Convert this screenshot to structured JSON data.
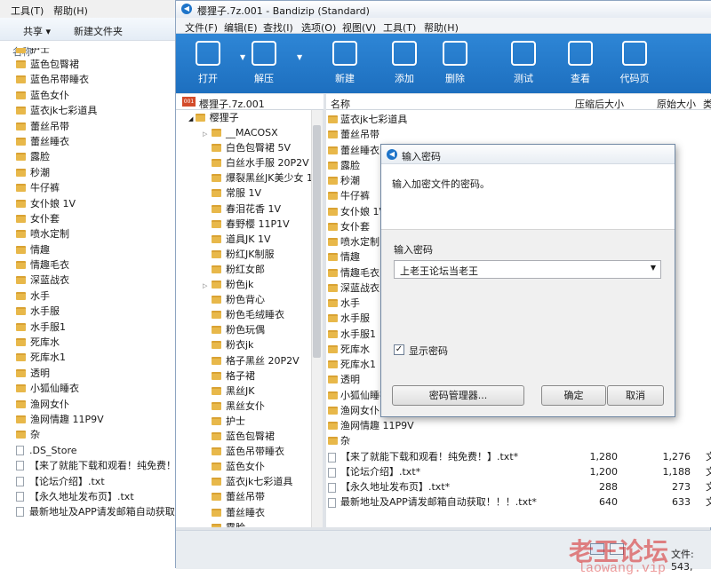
{
  "explorer": {
    "menu": [
      "工具(T)",
      "帮助(H)"
    ],
    "toolbar": {
      "share": "共享 ▾",
      "new_folder": "新建文件夹"
    },
    "col_name": "名称",
    "partial_top": "护士",
    "items": [
      {
        "n": "蓝色包臀裙",
        "t": "folder"
      },
      {
        "n": "蓝色吊带睡衣",
        "t": "folder"
      },
      {
        "n": "蓝色女仆",
        "t": "folder"
      },
      {
        "n": "蓝衣jk七彩道具",
        "t": "folder"
      },
      {
        "n": "蕾丝吊带",
        "t": "folder"
      },
      {
        "n": "蕾丝睡衣",
        "t": "folder"
      },
      {
        "n": "露脸",
        "t": "folder"
      },
      {
        "n": "秒潮",
        "t": "folder"
      },
      {
        "n": "牛仔裤",
        "t": "folder"
      },
      {
        "n": "女仆娘 1V",
        "t": "folder"
      },
      {
        "n": "女仆套",
        "t": "folder"
      },
      {
        "n": "喷水定制",
        "t": "folder"
      },
      {
        "n": "情趣",
        "t": "folder"
      },
      {
        "n": "情趣毛衣",
        "t": "folder"
      },
      {
        "n": "深蓝战衣",
        "t": "folder"
      },
      {
        "n": "水手",
        "t": "folder"
      },
      {
        "n": "水手服",
        "t": "folder"
      },
      {
        "n": "水手服1",
        "t": "folder"
      },
      {
        "n": "死库水",
        "t": "folder"
      },
      {
        "n": "死库水1",
        "t": "folder"
      },
      {
        "n": "透明",
        "t": "folder"
      },
      {
        "n": "小狐仙睡衣",
        "t": "folder"
      },
      {
        "n": "渔网女仆",
        "t": "folder"
      },
      {
        "n": "渔网情趣 11P9V",
        "t": "folder"
      },
      {
        "n": "杂",
        "t": "folder"
      },
      {
        "n": ".DS_Store",
        "t": "file"
      },
      {
        "n": "【来了就能下载和观看！纯免费！】.txt",
        "t": "file"
      },
      {
        "n": "【论坛介绍】.txt",
        "t": "file"
      },
      {
        "n": "【永久地址发布页】.txt",
        "t": "file"
      },
      {
        "n": "最新地址及APP请发邮箱自动获取！！！.txt",
        "t": "file"
      }
    ]
  },
  "bandizip": {
    "title": "樱狸子.7z.001 - Bandizip (Standard)",
    "menu": [
      "文件(F)",
      "编辑(E)",
      "查找(I)",
      "选项(O)",
      "视图(V)",
      "工具(T)",
      "帮助(H)"
    ],
    "toolbar": [
      {
        "label": "打开",
        "icon": "open-icon"
      },
      {
        "label": "解压",
        "icon": "extract-icon"
      },
      {
        "label": "新建",
        "icon": "new-archive-icon"
      },
      {
        "label": "添加",
        "icon": "add-icon"
      },
      {
        "label": "删除",
        "icon": "delete-icon"
      },
      {
        "label": "测试",
        "icon": "test-icon"
      },
      {
        "label": "查看",
        "icon": "view-icon"
      },
      {
        "label": "代码页",
        "icon": "codepage-icon"
      }
    ],
    "archive_name": "樱狸子.7z.001",
    "tree_root": "樱狸子",
    "tree_items": [
      "__MACOSX",
      "白色包臀裙 5V",
      "白丝水手服 20P2V",
      "爆裂黑丝JK美少女 1",
      "常服 1V",
      "春泪花香 1V",
      "春野樱 11P1V",
      "道具JK 1V",
      "粉红JK制服",
      "粉红女郎",
      "粉色jk",
      "粉色背心",
      "粉色毛绒睡衣",
      "粉色玩偶",
      "粉衣jk",
      "格子黑丝 20P2V",
      "格子裙",
      "黑丝JK",
      "黑丝女仆",
      "护士",
      "蓝色包臀裙",
      "蓝色吊带睡衣",
      "蓝色女仆",
      "蓝衣jk七彩道具",
      "蕾丝吊带",
      "蕾丝睡衣",
      "露脸"
    ],
    "columns": {
      "name": "名称",
      "packed": "压缩后大小",
      "original": "原始大小",
      "type": "类"
    },
    "list_items": [
      {
        "n": "蓝衣jk七彩道具",
        "t": "folder"
      },
      {
        "n": "蕾丝吊带",
        "t": "folder"
      },
      {
        "n": "蕾丝睡衣",
        "t": "folder"
      },
      {
        "n": "露脸",
        "t": "folder"
      },
      {
        "n": "秒潮",
        "t": "folder"
      },
      {
        "n": "牛仔裤",
        "t": "folder"
      },
      {
        "n": "女仆娘 1V",
        "t": "folder"
      },
      {
        "n": "女仆套",
        "t": "folder"
      },
      {
        "n": "喷水定制",
        "t": "folder"
      },
      {
        "n": "情趣",
        "t": "folder"
      },
      {
        "n": "情趣毛衣",
        "t": "folder"
      },
      {
        "n": "深蓝战衣",
        "t": "folder"
      },
      {
        "n": "水手",
        "t": "folder"
      },
      {
        "n": "水手服",
        "t": "folder"
      },
      {
        "n": "水手服1",
        "t": "folder"
      },
      {
        "n": "死库水",
        "t": "folder"
      },
      {
        "n": "死库水1",
        "t": "folder"
      },
      {
        "n": "透明",
        "t": "folder"
      },
      {
        "n": "小狐仙睡衣",
        "t": "folder"
      },
      {
        "n": "渔网女仆",
        "t": "folder"
      },
      {
        "n": "渔网情趣 11P9V",
        "t": "folder"
      },
      {
        "n": "杂",
        "t": "folder"
      },
      {
        "n": "【来了就能下载和观看！纯免费！】.txt*",
        "t": "file",
        "packed": "1,280",
        "orig": "1,276",
        "type": "文"
      },
      {
        "n": "【论坛介绍】.txt*",
        "t": "file",
        "packed": "1,200",
        "orig": "1,188",
        "type": "文"
      },
      {
        "n": "【永久地址发布页】.txt*",
        "t": "file",
        "packed": "288",
        "orig": "273",
        "type": "文"
      },
      {
        "n": "最新地址及APP请发邮箱自动获取！！！.txt*",
        "t": "file",
        "packed": "640",
        "orig": "633",
        "type": "文"
      }
    ],
    "status": "文件: 543,"
  },
  "dialog": {
    "title": "输入密码",
    "instruction": "输入加密文件的密码。",
    "pw_label": "输入密码",
    "pw_value": "上老王论坛当老王",
    "show_pw": "显示密码",
    "btn_manager": "密码管理器...",
    "btn_ok": "确定",
    "btn_cancel": "取消"
  },
  "watermark": {
    "text": "老王论坛",
    "url": "laowang.vip"
  }
}
